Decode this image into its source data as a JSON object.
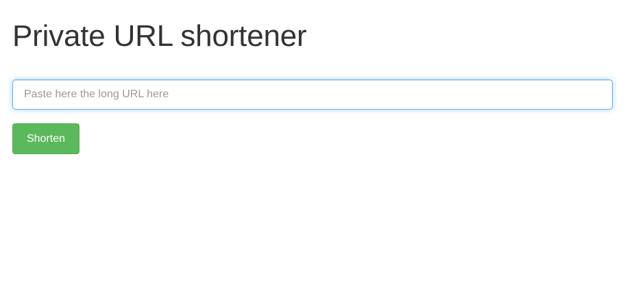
{
  "page": {
    "title": "Private URL shortener"
  },
  "form": {
    "url_input": {
      "value": "",
      "placeholder": "Paste here the long URL here"
    },
    "shorten_button_label": "Shorten"
  },
  "colors": {
    "button_background": "#5cb85c",
    "button_border": "#4cae4c",
    "input_focus_border": "#66afe9",
    "title_text": "#333333"
  }
}
